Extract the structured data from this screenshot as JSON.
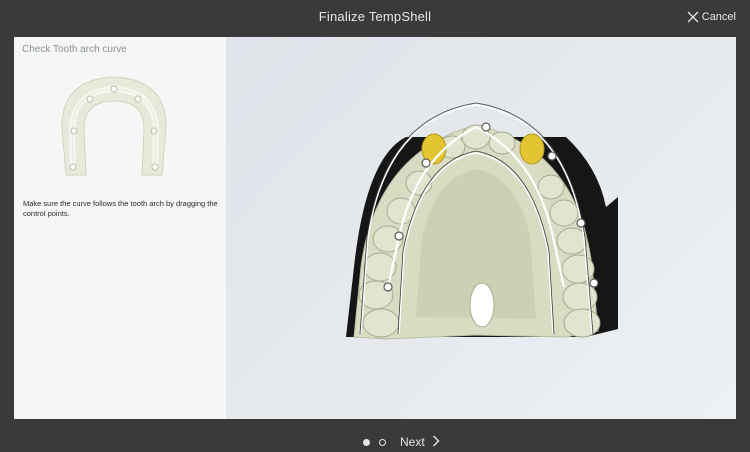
{
  "window": {
    "title": "Finalize TempShell",
    "cancel_label": "Cancel"
  },
  "panel": {
    "title": "Check Tooth arch curve",
    "instruction": "Make sure the curve follows the tooth arch by dragging the control points."
  },
  "footer": {
    "next_label": "Next",
    "steps_total": 2,
    "current_step": 1
  },
  "colors": {
    "chrome": "#3a3a3a",
    "highlight_tooth": "#e3c533",
    "model": "#dcdfc4"
  },
  "icons": {
    "cancel": "close-icon",
    "next": "chevron-right-icon"
  }
}
